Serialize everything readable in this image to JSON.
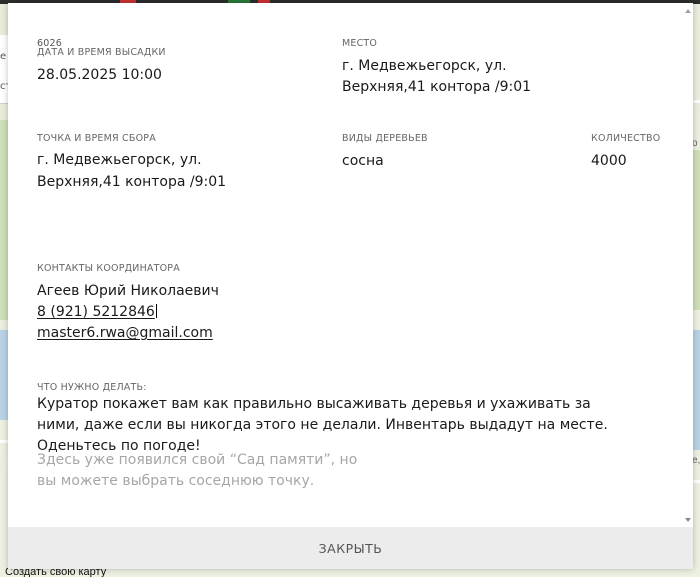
{
  "background": {
    "map_link": "Создать свою карту"
  },
  "modal": {
    "id_number": "6026",
    "planting": {
      "label": "ДАТА И ВРЕМЯ ВЫСАДКИ",
      "value": "28.05.2025 10:00"
    },
    "place": {
      "label": "МЕСТО",
      "line1": "г. Медвежьегорск, ул.",
      "line2": "Верхняя,41 контора /9:01"
    },
    "meeting_point": {
      "label": "ТОЧКА И ВРЕМЯ СБОРА",
      "line1": "г. Медвежьегорск, ул.",
      "line2": "Верхняя,41 контора /9:01"
    },
    "tree_types": {
      "label": "ВИДЫ ДЕРЕВЬЕВ",
      "value": "сосна"
    },
    "quantity": {
      "label": "КОЛИЧЕСТВО",
      "value": "4000"
    },
    "coordinator": {
      "label": "КОНТАКТЫ КООРДИНАТОРА",
      "name": "Агеев Юрий Николаевич",
      "phone": "8 (921) 5212846",
      "email": "master6.rwa@gmail.com"
    },
    "todo": {
      "label": "ЧТО НУЖНО ДЕЛАТЬ:",
      "text": "Куратор покажет вам как правильно высаживать деревья и ухаживать за ними, даже если вы никогда этого не делали. Инвентарь выдадут на месте. Оденьтесь по погоде!"
    },
    "note": {
      "text": "Здесь уже появился свой “Сад памяти”, но вы можете выбрать соседнюю точку."
    },
    "close_label": "ЗАКРЫТЬ"
  },
  "colors": {
    "modal_bg": "#ffffff",
    "label": "#666666",
    "text": "#1a1a1a",
    "muted": "#a6a6a6",
    "close_bar": "#ececec"
  }
}
